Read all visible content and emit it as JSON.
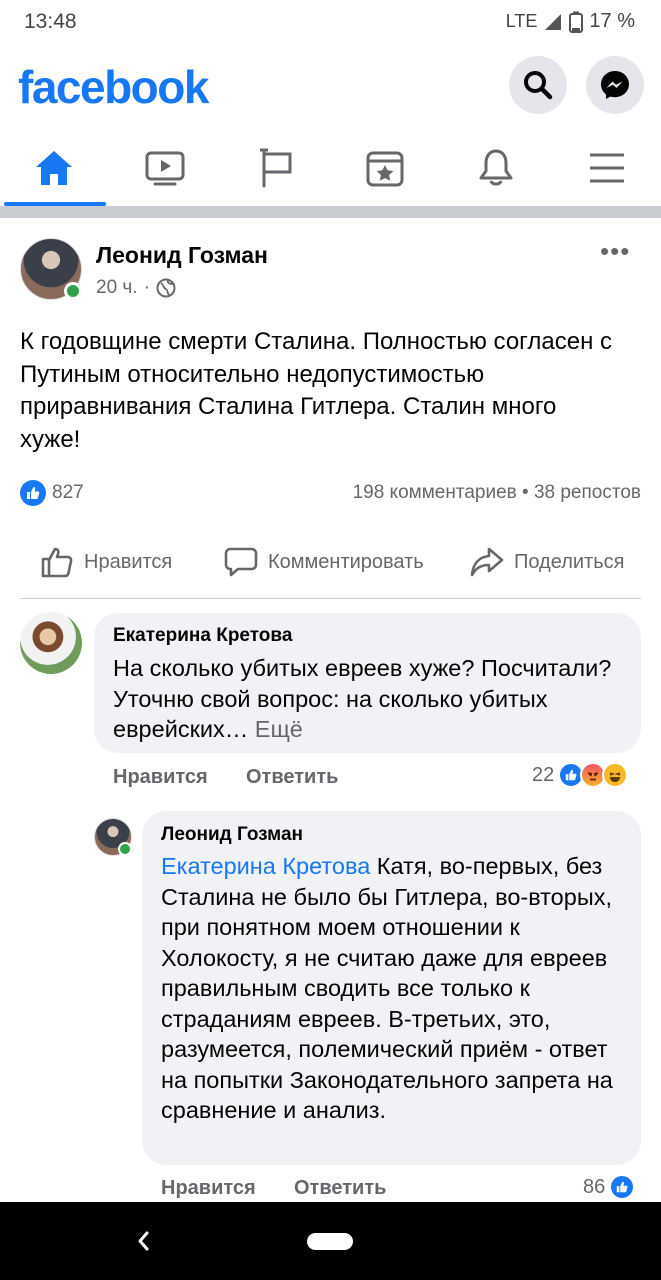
{
  "status_bar": {
    "time": "13:48",
    "network": "LTE",
    "battery": "17 %"
  },
  "header": {
    "logo": "facebook",
    "search_icon": "search-icon",
    "messenger_icon": "messenger-icon"
  },
  "nav_tabs": [
    {
      "name": "home",
      "icon": "home-icon",
      "active": true
    },
    {
      "name": "watch",
      "icon": "video-icon",
      "active": false
    },
    {
      "name": "pages",
      "icon": "flag-icon",
      "active": false
    },
    {
      "name": "events",
      "icon": "calendar-star-icon",
      "active": false
    },
    {
      "name": "notifications",
      "icon": "bell-icon",
      "active": false
    },
    {
      "name": "menu",
      "icon": "hamburger-icon",
      "active": false
    }
  ],
  "post": {
    "author": "Леонид Гозман",
    "time": "20 ч.",
    "separator": "·",
    "privacy_icon": "globe-icon",
    "more": "•••",
    "text": "К годовщине смерти Сталина. Полностью согласен с Путиным относительно недопустимостью приравнивания Сталина Гитлера. Сталин много хуже!",
    "likes": "827",
    "stats": "198 комментариев • 38 репостов",
    "actions": {
      "like": "Нравится",
      "comment": "Комментировать",
      "share": "Поделиться"
    }
  },
  "comments": [
    {
      "author": "Екатерина Кретова",
      "text": "На сколько убитых евреев хуже? Посчитали? Уточню свой вопрос: на сколько убитых еврейских…",
      "more": " Ещё",
      "like_action": "Нравится",
      "reply_action": "Ответить",
      "reaction_count": "22"
    },
    {
      "author": "Леонид Гозман",
      "mention": "Екатерина Кретова",
      "text": " Катя, во-первых, без Сталина не было бы Гитлера, во-вторых, при понятном моем отношении к Холокосту, я не считаю даже для евреев правильным сводить все только к страданиям евреев. В-третьих, это, разумеется, полемический приём - ответ на попытки Законодательного запрета на сравнение и анализ.",
      "like_action": "Нравится",
      "reply_action": "Ответить",
      "reaction_count": "86"
    }
  ],
  "colors": {
    "brand": "#1877f2",
    "secondary_text": "#65676b",
    "bubble": "#f0f2f5",
    "online": "#31a24c"
  }
}
